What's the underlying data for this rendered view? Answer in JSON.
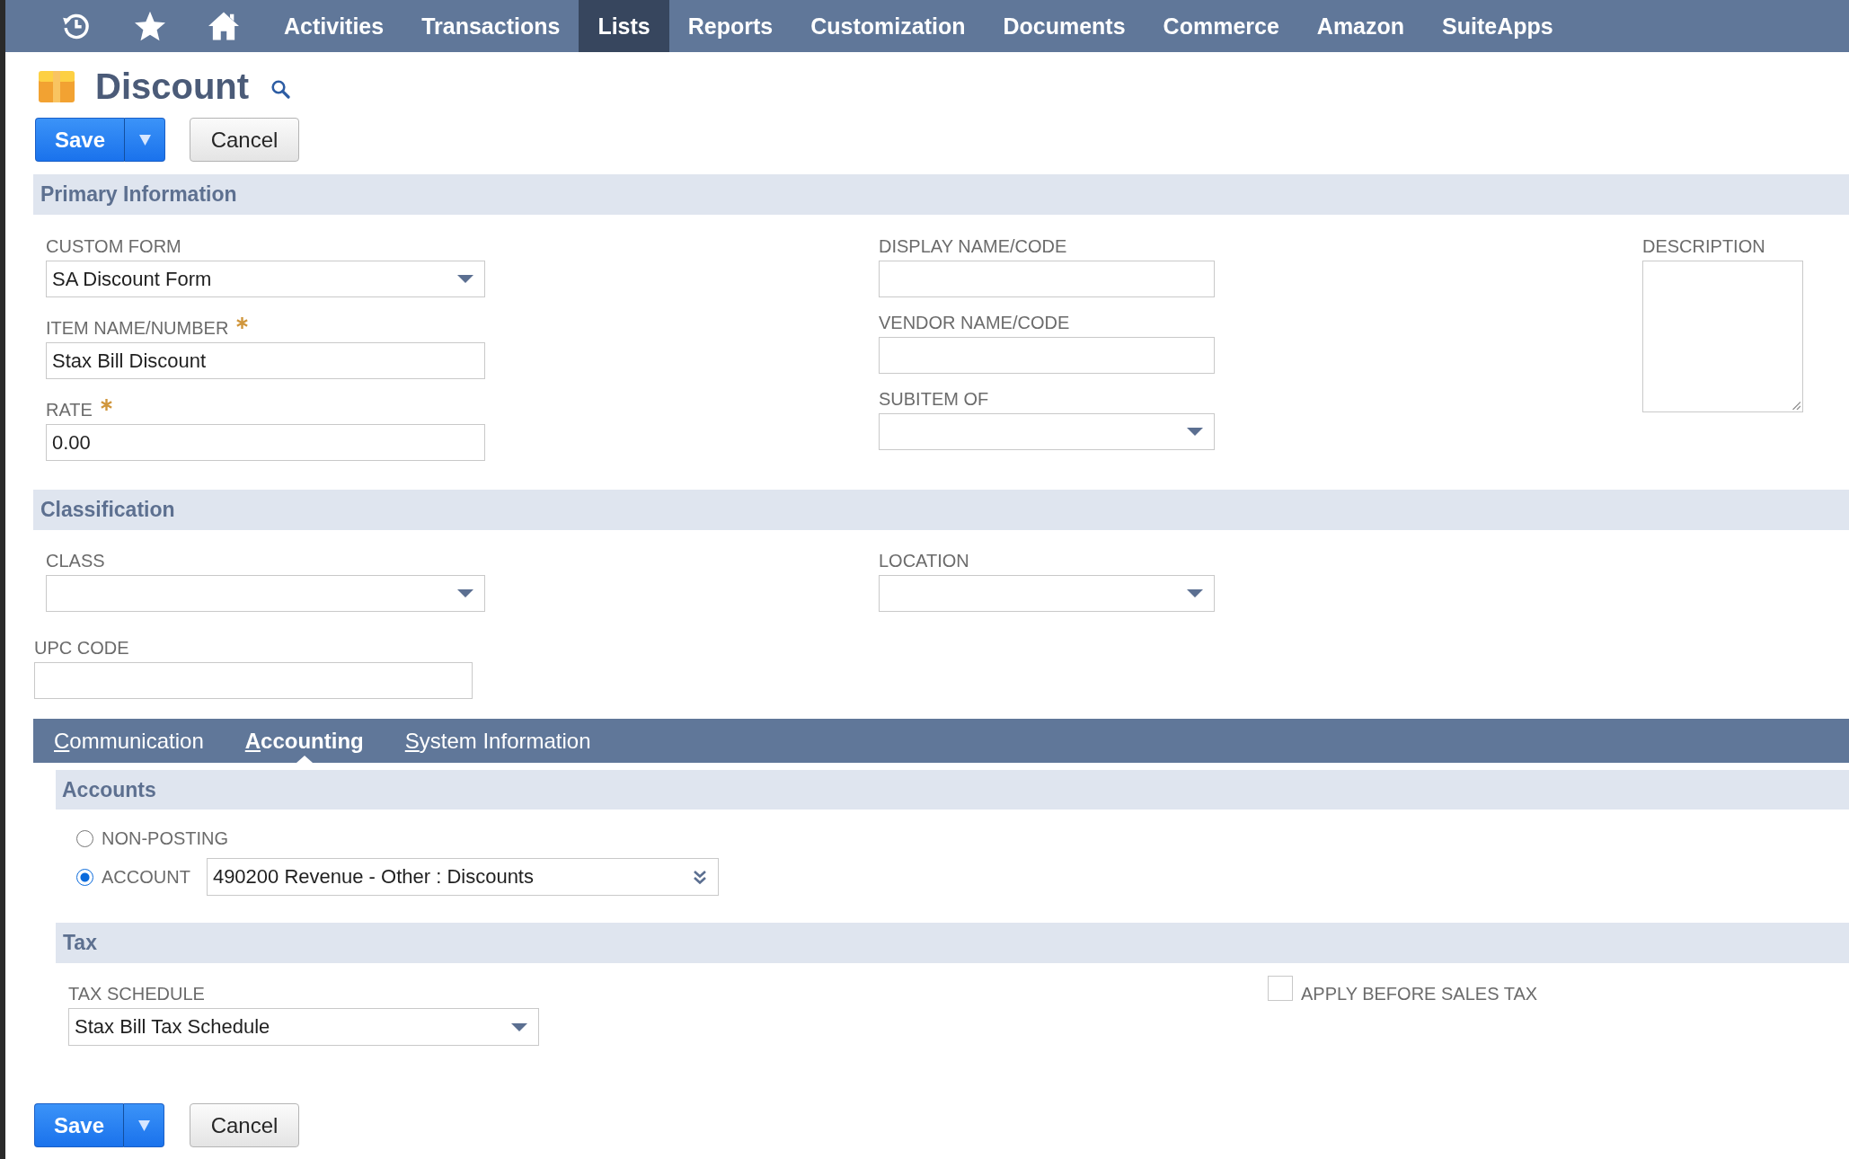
{
  "nav": {
    "items": [
      {
        "label": "Activities",
        "selected": false
      },
      {
        "label": "Transactions",
        "selected": false
      },
      {
        "label": "Lists",
        "selected": true
      },
      {
        "label": "Reports",
        "selected": false
      },
      {
        "label": "Customization",
        "selected": false
      },
      {
        "label": "Documents",
        "selected": false
      },
      {
        "label": "Commerce",
        "selected": false
      },
      {
        "label": "Amazon",
        "selected": false
      },
      {
        "label": "SuiteApps",
        "selected": false
      }
    ]
  },
  "page": {
    "title": "Discount"
  },
  "top_buttons": [
    {
      "label": "Save",
      "kind": "split"
    },
    {
      "label": "Cancel",
      "kind": "plain"
    }
  ],
  "primary_information": {
    "title": "Primary Information",
    "columns": [
      [
        {
          "label": "CUSTOM FORM",
          "kind": "select",
          "required": false,
          "value": "SA Discount Form"
        },
        {
          "label": "ITEM NAME/NUMBER",
          "kind": "text",
          "required": true,
          "value": "Stax Bill Discount"
        },
        {
          "label": "RATE",
          "kind": "text",
          "required": true,
          "value": "0.00"
        }
      ],
      [
        {
          "label": "DISPLAY NAME/CODE",
          "kind": "text",
          "required": false
        },
        {
          "label": "VENDOR NAME/CODE",
          "kind": "text",
          "required": false
        },
        {
          "label": "SUBITEM OF",
          "kind": "select",
          "required": false
        }
      ],
      [
        {
          "label": "DESCRIPTION",
          "kind": "textarea",
          "required": false
        }
      ]
    ]
  },
  "classification": {
    "title": "Classification",
    "columns": [
      [
        {
          "label": "CLASS",
          "kind": "select",
          "required": false
        }
      ],
      [
        {
          "label": "LOCATION",
          "kind": "select",
          "required": false
        }
      ]
    ],
    "upc_code": {
      "label": "UPC CODE",
      "kind": "text",
      "required": false
    }
  },
  "subtabs": {
    "tabs": [
      {
        "label": "Communication",
        "selected": false
      },
      {
        "label": "Accounting",
        "selected": true
      },
      {
        "label": "System Information",
        "selected": false
      }
    ]
  },
  "accounting": {
    "accounts": {
      "title": "Accounts",
      "options": [
        {
          "label": "NON-POSTING",
          "selected": false
        },
        {
          "label": "ACCOUNT",
          "selected": true,
          "field": {
            "value": "490200 Revenue - Other : Discounts"
          }
        }
      ]
    },
    "tax": {
      "title": "Tax",
      "fields": [
        {
          "label": "TAX SCHEDULE",
          "kind": "select",
          "required": false,
          "value": "Stax Bill Tax Schedule"
        }
      ],
      "checkbox": {
        "label": "APPLY BEFORE SALES TAX",
        "checked": false
      }
    }
  },
  "bottom_buttons": [
    {
      "label": "Save",
      "kind": "split"
    },
    {
      "label": "Cancel",
      "kind": "plain"
    }
  ]
}
